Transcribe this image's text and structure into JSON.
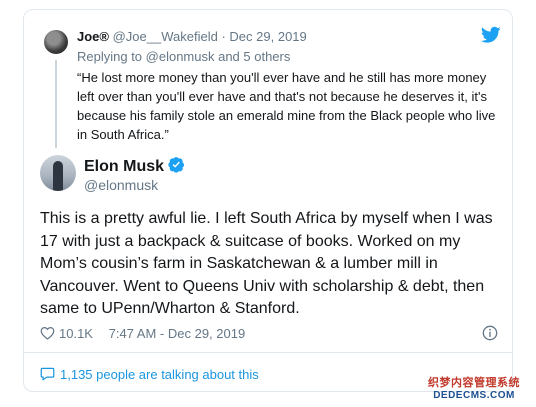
{
  "reply": {
    "name": "Joe®",
    "handle": "@Joe__Wakefield",
    "separator": "·",
    "date": "Dec 29, 2019",
    "replying_to": "Replying to @elonmusk and 5 others",
    "text": "“He lost more money than you'll ever have and he still has more money left over than you'll ever have and that's not because he deserves it, it's because his family stole an emerald mine from the Black people who live in South Africa.”"
  },
  "tweet": {
    "name": "Elon Musk",
    "handle": "@elonmusk",
    "text": "This is a pretty awful lie. I left South Africa by myself when I was 17 with just a backpack & suitcase of books. Worked on my Mom’s cousin’s farm in Saskatchewan & a lumber mill in Vancouver. Went to Queens Univ with scholarship & debt, then same to UPenn/Wharton & Stanford.",
    "likes": "10.1K",
    "timestamp": "7:47 AM - Dec 29, 2019"
  },
  "footer": {
    "talking": "1,135 people are talking about this"
  },
  "watermark": {
    "line1": "织梦内容管理系统",
    "line2": "DEDECMS.COM"
  },
  "icons": {
    "brand": "twitter-bird-icon",
    "verified": "verified-badge-icon",
    "like": "heart-icon",
    "info": "info-icon",
    "conversation": "speech-bubble-icon"
  },
  "colors": {
    "accent": "#1da1f2",
    "link": "#1b95e0",
    "muted": "#657786",
    "border": "#e1e8ed"
  }
}
